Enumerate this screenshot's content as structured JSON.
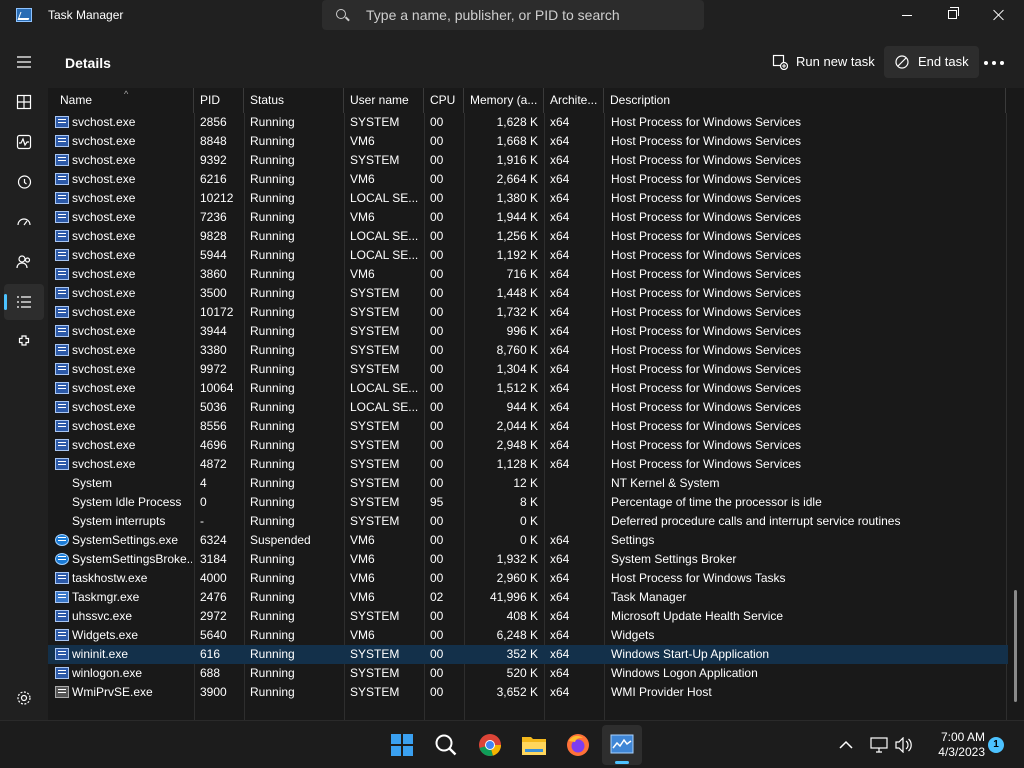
{
  "window": {
    "title": "Task Manager",
    "search_placeholder": "Type a name, publisher, or PID to search"
  },
  "sidebar": {
    "items": [
      {
        "name": "hamburger-menu-icon"
      },
      {
        "name": "processes-icon"
      },
      {
        "name": "performance-icon"
      },
      {
        "name": "app-history-icon"
      },
      {
        "name": "startup-apps-icon"
      },
      {
        "name": "users-icon"
      },
      {
        "name": "details-icon",
        "active": true
      },
      {
        "name": "services-icon"
      }
    ],
    "settings_icon": "gear-icon"
  },
  "header": {
    "title": "Details",
    "run_new_task": "Run new task",
    "end_task": "End task"
  },
  "table": {
    "columns": [
      "Name",
      "PID",
      "Status",
      "User name",
      "CPU",
      "Memory (a...",
      "Archite...",
      "Description"
    ],
    "rows": [
      {
        "name": "svchost.exe",
        "pid": "2856",
        "status": "Running",
        "user": "SYSTEM",
        "cpu": "00",
        "mem": "1,628 K",
        "arch": "x64",
        "desc": "Host Process for Windows Services",
        "icon": "svc"
      },
      {
        "name": "svchost.exe",
        "pid": "8848",
        "status": "Running",
        "user": "VM6",
        "cpu": "00",
        "mem": "1,668 K",
        "arch": "x64",
        "desc": "Host Process for Windows Services",
        "icon": "svc"
      },
      {
        "name": "svchost.exe",
        "pid": "9392",
        "status": "Running",
        "user": "SYSTEM",
        "cpu": "00",
        "mem": "1,916 K",
        "arch": "x64",
        "desc": "Host Process for Windows Services",
        "icon": "svc"
      },
      {
        "name": "svchost.exe",
        "pid": "6216",
        "status": "Running",
        "user": "VM6",
        "cpu": "00",
        "mem": "2,664 K",
        "arch": "x64",
        "desc": "Host Process for Windows Services",
        "icon": "svc"
      },
      {
        "name": "svchost.exe",
        "pid": "10212",
        "status": "Running",
        "user": "LOCAL SE...",
        "cpu": "00",
        "mem": "1,380 K",
        "arch": "x64",
        "desc": "Host Process for Windows Services",
        "icon": "svc"
      },
      {
        "name": "svchost.exe",
        "pid": "7236",
        "status": "Running",
        "user": "VM6",
        "cpu": "00",
        "mem": "1,944 K",
        "arch": "x64",
        "desc": "Host Process for Windows Services",
        "icon": "svc"
      },
      {
        "name": "svchost.exe",
        "pid": "9828",
        "status": "Running",
        "user": "LOCAL SE...",
        "cpu": "00",
        "mem": "1,256 K",
        "arch": "x64",
        "desc": "Host Process for Windows Services",
        "icon": "svc"
      },
      {
        "name": "svchost.exe",
        "pid": "5944",
        "status": "Running",
        "user": "LOCAL SE...",
        "cpu": "00",
        "mem": "1,192 K",
        "arch": "x64",
        "desc": "Host Process for Windows Services",
        "icon": "svc"
      },
      {
        "name": "svchost.exe",
        "pid": "3860",
        "status": "Running",
        "user": "VM6",
        "cpu": "00",
        "mem": "716 K",
        "arch": "x64",
        "desc": "Host Process for Windows Services",
        "icon": "svc"
      },
      {
        "name": "svchost.exe",
        "pid": "3500",
        "status": "Running",
        "user": "SYSTEM",
        "cpu": "00",
        "mem": "1,448 K",
        "arch": "x64",
        "desc": "Host Process for Windows Services",
        "icon": "svc"
      },
      {
        "name": "svchost.exe",
        "pid": "10172",
        "status": "Running",
        "user": "SYSTEM",
        "cpu": "00",
        "mem": "1,732 K",
        "arch": "x64",
        "desc": "Host Process for Windows Services",
        "icon": "svc"
      },
      {
        "name": "svchost.exe",
        "pid": "3944",
        "status": "Running",
        "user": "SYSTEM",
        "cpu": "00",
        "mem": "996 K",
        "arch": "x64",
        "desc": "Host Process for Windows Services",
        "icon": "svc"
      },
      {
        "name": "svchost.exe",
        "pid": "3380",
        "status": "Running",
        "user": "SYSTEM",
        "cpu": "00",
        "mem": "8,760 K",
        "arch": "x64",
        "desc": "Host Process for Windows Services",
        "icon": "svc"
      },
      {
        "name": "svchost.exe",
        "pid": "9972",
        "status": "Running",
        "user": "SYSTEM",
        "cpu": "00",
        "mem": "1,304 K",
        "arch": "x64",
        "desc": "Host Process for Windows Services",
        "icon": "svc"
      },
      {
        "name": "svchost.exe",
        "pid": "10064",
        "status": "Running",
        "user": "LOCAL SE...",
        "cpu": "00",
        "mem": "1,512 K",
        "arch": "x64",
        "desc": "Host Process for Windows Services",
        "icon": "svc"
      },
      {
        "name": "svchost.exe",
        "pid": "5036",
        "status": "Running",
        "user": "LOCAL SE...",
        "cpu": "00",
        "mem": "944 K",
        "arch": "x64",
        "desc": "Host Process for Windows Services",
        "icon": "svc"
      },
      {
        "name": "svchost.exe",
        "pid": "8556",
        "status": "Running",
        "user": "SYSTEM",
        "cpu": "00",
        "mem": "2,044 K",
        "arch": "x64",
        "desc": "Host Process for Windows Services",
        "icon": "svc"
      },
      {
        "name": "svchost.exe",
        "pid": "4696",
        "status": "Running",
        "user": "SYSTEM",
        "cpu": "00",
        "mem": "2,948 K",
        "arch": "x64",
        "desc": "Host Process for Windows Services",
        "icon": "svc"
      },
      {
        "name": "svchost.exe",
        "pid": "4872",
        "status": "Running",
        "user": "SYSTEM",
        "cpu": "00",
        "mem": "1,128 K",
        "arch": "x64",
        "desc": "Host Process for Windows Services",
        "icon": "svc"
      },
      {
        "name": "System",
        "pid": "4",
        "status": "Running",
        "user": "SYSTEM",
        "cpu": "00",
        "mem": "12 K",
        "arch": "",
        "desc": "NT Kernel & System",
        "icon": "none"
      },
      {
        "name": "System Idle Process",
        "pid": "0",
        "status": "Running",
        "user": "SYSTEM",
        "cpu": "95",
        "mem": "8 K",
        "arch": "",
        "desc": "Percentage of time the processor is idle",
        "icon": "none"
      },
      {
        "name": "System interrupts",
        "pid": "-",
        "status": "Running",
        "user": "SYSTEM",
        "cpu": "00",
        "mem": "0 K",
        "arch": "",
        "desc": "Deferred procedure calls and interrupt service routines",
        "icon": "none"
      },
      {
        "name": "SystemSettings.exe",
        "pid": "6324",
        "status": "Suspended",
        "user": "VM6",
        "cpu": "00",
        "mem": "0 K",
        "arch": "x64",
        "desc": "Settings",
        "icon": "gear"
      },
      {
        "name": "SystemSettingsBroke...",
        "pid": "3184",
        "status": "Running",
        "user": "VM6",
        "cpu": "00",
        "mem": "1,932 K",
        "arch": "x64",
        "desc": "System Settings Broker",
        "icon": "gear"
      },
      {
        "name": "taskhostw.exe",
        "pid": "4000",
        "status": "Running",
        "user": "VM6",
        "cpu": "00",
        "mem": "2,960 K",
        "arch": "x64",
        "desc": "Host Process for Windows Tasks",
        "icon": "svc"
      },
      {
        "name": "Taskmgr.exe",
        "pid": "2476",
        "status": "Running",
        "user": "VM6",
        "cpu": "02",
        "mem": "41,996 K",
        "arch": "x64",
        "desc": "Task Manager",
        "icon": "tm"
      },
      {
        "name": "uhssvc.exe",
        "pid": "2972",
        "status": "Running",
        "user": "SYSTEM",
        "cpu": "00",
        "mem": "408 K",
        "arch": "x64",
        "desc": "Microsoft Update Health Service",
        "icon": "svc"
      },
      {
        "name": "Widgets.exe",
        "pid": "5640",
        "status": "Running",
        "user": "VM6",
        "cpu": "00",
        "mem": "6,248 K",
        "arch": "x64",
        "desc": "Widgets",
        "icon": "svc"
      },
      {
        "name": "wininit.exe",
        "pid": "616",
        "status": "Running",
        "user": "SYSTEM",
        "cpu": "00",
        "mem": "352 K",
        "arch": "x64",
        "desc": "Windows Start-Up Application",
        "icon": "svc",
        "selected": true
      },
      {
        "name": "winlogon.exe",
        "pid": "688",
        "status": "Running",
        "user": "SYSTEM",
        "cpu": "00",
        "mem": "520 K",
        "arch": "x64",
        "desc": "Windows Logon Application",
        "icon": "svc"
      },
      {
        "name": "WmiPrvSE.exe",
        "pid": "3900",
        "status": "Running",
        "user": "SYSTEM",
        "cpu": "00",
        "mem": "3,652 K",
        "arch": "x64",
        "desc": "WMI Provider Host",
        "icon": "gray"
      }
    ]
  },
  "taskbar": {
    "apps": [
      "start-icon",
      "search-icon",
      "chrome-icon",
      "file-explorer-icon",
      "firefox-icon",
      "task-manager-icon"
    ],
    "time": "7:00 AM",
    "date": "4/3/2023",
    "notification_count": "1"
  },
  "colors": {
    "accent": "#4cc2ff",
    "selected_row": "#13304a",
    "background": "#191919"
  }
}
